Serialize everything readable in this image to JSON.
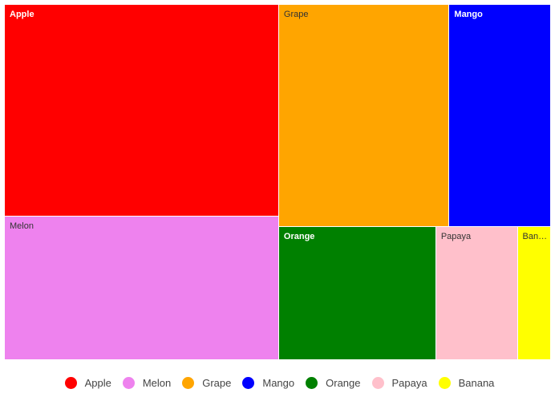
{
  "chart_data": {
    "type": "treemap",
    "title": "",
    "legend_position": "bottom-center",
    "series": [
      {
        "name": "Apple",
        "value": 72,
        "color": "#ff0000",
        "label_color": "#ffffff"
      },
      {
        "name": "Melon",
        "value": 49,
        "color": "#ee82ee",
        "label_color": "#333333"
      },
      {
        "name": "Grape",
        "value": 47,
        "color": "#ffa500",
        "label_color": "#333333"
      },
      {
        "name": "Mango",
        "value": 28,
        "color": "#0000ff",
        "label_color": "#ffffff"
      },
      {
        "name": "Orange",
        "value": 26,
        "color": "#008000",
        "label_color": "#ffffff"
      },
      {
        "name": "Papaya",
        "value": 13.5,
        "color": "#ffc0cb",
        "label_color": "#333333"
      },
      {
        "name": "Banana",
        "value": 5.5,
        "color": "#ffff00",
        "label_color": "#333333",
        "label_display": "Bana..."
      }
    ]
  }
}
